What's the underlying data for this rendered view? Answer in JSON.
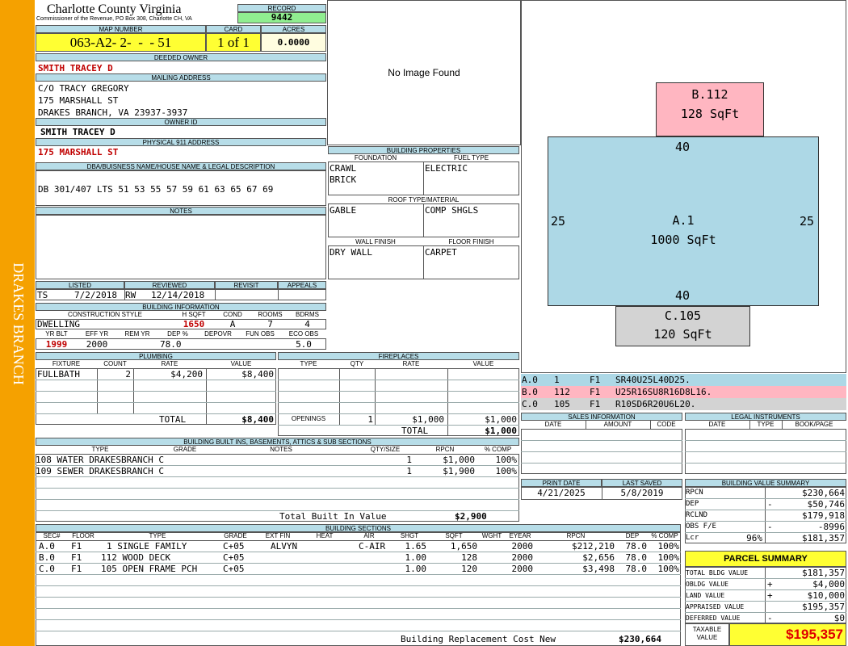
{
  "side_label": "DRAKES BRANCH",
  "county": {
    "title": "Charlotte County Virginia",
    "subtitle": "Commissioner of the Revenue, PO Box 308, Charlotte CH, VA"
  },
  "record": {
    "label": "RECORD",
    "value": "9442"
  },
  "map": {
    "label": "MAP NUMBER",
    "value": "063-A2- 2-  -  - 51"
  },
  "card": {
    "label": "CARD",
    "value": "1 of 1"
  },
  "acres": {
    "label": "ACRES",
    "value": "0.0000"
  },
  "deeded_owner": {
    "label": "DEEDED OWNER",
    "value": "SMITH TRACEY D"
  },
  "mailing": {
    "label": "MAILING ADDRESS",
    "line1": "C/O TRACY GREGORY",
    "line2": "175 MARSHALL ST",
    "line3": "DRAKES BRANCH, VA 23937-3937"
  },
  "owner_id": {
    "label": "OWNER ID",
    "value": "SMITH TRACEY D"
  },
  "physical": {
    "label": "PHYSICAL 911 ADDRESS",
    "value": "175 MARSHALL ST"
  },
  "dba": {
    "label": "DBA/BUISNESS NAME/HOUSE NAME & LEGAL DESCRIPTION",
    "value": "DB 301/407 LTS 51 53 55 57 59 61 63 65 67 69"
  },
  "notes": {
    "label": "NOTES"
  },
  "listed": {
    "label": "LISTED",
    "by": "TS",
    "date": "7/2/2018"
  },
  "reviewed": {
    "label": "REVIEWED",
    "by": "RW",
    "date": "12/14/2018"
  },
  "revisit": {
    "label": "REVISIT"
  },
  "appeals": {
    "label": "APPEALS"
  },
  "building_info": {
    "label": "BUILDING INFORMATION",
    "h_style": "CONSTRUCTION STYLE",
    "h_hsqft": "H SQFT",
    "h_cond": "COND",
    "h_rooms": "ROOMS",
    "h_bdrms": "BDRMS",
    "style": "DWELLING",
    "hsqft": "1650",
    "cond": "A",
    "rooms": "7",
    "bdrms": "4",
    "h_yrblt": "YR BLT",
    "h_effyr": "EFF YR",
    "h_remyr": "REM YR",
    "h_dep": "DEP %",
    "h_depovr": "DEPOVR",
    "h_funobs": "FUN OBS",
    "h_ecoobs": "ECO OBS",
    "yrblt": "1999",
    "effyr": "2000",
    "dep": "78.0",
    "ecoobs": "5.0"
  },
  "no_image": "No Image Found",
  "bldg_props": {
    "label": "BUILDING PROPERTIES",
    "h_foundation": "FOUNDATION",
    "h_fuel": "FUEL TYPE",
    "foundation1": "CRAWL",
    "foundation2": "BRICK",
    "fuel": "ELECTRIC",
    "h_roof": "ROOF TYPE/MATERIAL",
    "roof_type": "GABLE",
    "roof_mat": "COMP SHGLS",
    "h_wall": "WALL FINISH",
    "h_floor": "FLOOR FINISH",
    "wall": "DRY WALL",
    "floor": "CARPET"
  },
  "sketch": {
    "b_label": "B.112",
    "b_area": "128 SqFt",
    "a_label": "A.1",
    "a_area": "1000 SqFt",
    "c_label": "C.105",
    "c_area": "120 SqFt",
    "top": "40",
    "bottom": "40",
    "left": "25",
    "right": "25",
    "colors": {
      "a": "#add8e6",
      "b": "#ffb6c1",
      "c": "#d3d3d3"
    }
  },
  "sketch_codes": [
    {
      "sec": "A.0",
      "n": "1",
      "fl": "F1",
      "path": "SR40U25L40D25."
    },
    {
      "sec": "B.0",
      "n": "112",
      "fl": "F1",
      "path": "U25R16SU8R16D8L16."
    },
    {
      "sec": "C.0",
      "n": "105",
      "fl": "F1",
      "path": "R10SD6R20U6L20."
    }
  ],
  "plumbing": {
    "label": "PLUMBING",
    "h_fixture": "FIXTURE",
    "h_count": "COUNT",
    "h_rate": "RATE",
    "h_value": "VALUE",
    "fixture": "FULLBATH",
    "count": "2",
    "rate": "$4,200",
    "value": "$8,400",
    "total_label": "TOTAL",
    "total": "$8,400"
  },
  "fireplaces": {
    "label": "FIREPLACES",
    "h_type": "TYPE",
    "h_qty": "QTY",
    "h_rate": "RATE",
    "h_value": "VALUE",
    "openings_label": "OPENINGS",
    "qty": "1",
    "rate": "$1,000",
    "value": "$1,000",
    "total_label": "TOTAL",
    "total": "$1,000"
  },
  "sales": {
    "label": "SALES INFORMATION",
    "h_date": "DATE",
    "h_amount": "AMOUNT",
    "h_code": "CODE"
  },
  "legal": {
    "label": "LEGAL INSTRUMENTS",
    "h_date": "DATE",
    "h_type": "TYPE",
    "h_book": "BOOK/PAGE"
  },
  "builtins": {
    "label": "BUILDING BUILT INS, BASEMENTS, ATTICS & SUB SECTIONS",
    "h_type": "TYPE",
    "h_grade": "GRADE",
    "h_notes": "NOTES",
    "h_qty": "QTY/SIZE",
    "h_rpcn": "RPCN",
    "h_comp": "% COMP",
    "rows": [
      {
        "type": "108 WATER DRAKESBRANCH C",
        "qty": "1",
        "rpcn": "$1,000",
        "comp": "100%"
      },
      {
        "type": "109 SEWER DRAKESBRANCH C",
        "qty": "1",
        "rpcn": "$1,900",
        "comp": "100%"
      }
    ],
    "total_label": "Total Built In Value",
    "total": "$2,900"
  },
  "print": {
    "h_print": "PRINT DATE",
    "h_saved": "LAST SAVED",
    "print_date": "4/21/2025",
    "last_saved": "5/8/2019"
  },
  "value_summary": {
    "label": "BUILDING VALUE SUMMARY",
    "rows": [
      {
        "k": "RPCN",
        "s": "",
        "v": "$230,664"
      },
      {
        "k": "DEP",
        "s": "-",
        "v": "$50,746"
      },
      {
        "k": "RCLND",
        "s": "",
        "v": "$179,918"
      },
      {
        "k": "OBS F/E",
        "s": "-",
        "v": "-8996"
      },
      {
        "k": "Lcr",
        "p": "96%",
        "s": "",
        "v": "$181,357"
      }
    ]
  },
  "sections": {
    "label": "BUILDING SECTIONS",
    "h": [
      "SEC#",
      "FLOOR",
      "TYPE",
      "GRADE",
      "EXT FIN",
      "HEAT",
      "AIR",
      "SHGT",
      "SQFT",
      "WGHT",
      "EYEAR",
      "RPCN",
      "DEP",
      "% COMP"
    ],
    "rows": [
      {
        "sec": "A.0",
        "floor": "F1",
        "type": "1 SINGLE FAMILY",
        "grade": "C+05",
        "ext": "ALVYN",
        "heat": "",
        "air": "C-AIR",
        "shgt": "1.65",
        "sqft": "1,650",
        "wght": "",
        "eyear": "2000",
        "rpcn": "$212,210",
        "dep": "78.0",
        "comp": "100%"
      },
      {
        "sec": "B.0",
        "floor": "F1",
        "type": "112 WOOD DECK",
        "grade": "C+05",
        "ext": "",
        "heat": "",
        "air": "",
        "shgt": "1.00",
        "sqft": "128",
        "wght": "",
        "eyear": "2000",
        "rpcn": "$2,656",
        "dep": "78.0",
        "comp": "100%"
      },
      {
        "sec": "C.0",
        "floor": "F1",
        "type": "105 OPEN FRAME PCH",
        "grade": "C+05",
        "ext": "",
        "heat": "",
        "air": "",
        "shgt": "1.00",
        "sqft": "120",
        "wght": "",
        "eyear": "2000",
        "rpcn": "$3,498",
        "dep": "78.0",
        "comp": "100%"
      }
    ],
    "total_label": "Building Replacement Cost New",
    "total": "$230,664"
  },
  "parcel": {
    "label": "PARCEL SUMMARY",
    "rows": [
      {
        "k": "TOTAL BLDG VALUE",
        "s": "",
        "v": "$181,357"
      },
      {
        "k": "OBLDG VALUE",
        "s": "+",
        "v": "$4,000"
      },
      {
        "k": "LAND VALUE",
        "s": "+",
        "v": "$10,000"
      },
      {
        "k": "APPRAISED VALUE",
        "s": "",
        "v": "$195,357"
      },
      {
        "k": "DEFERRED VALUE",
        "s": "-",
        "v": "$0"
      }
    ],
    "taxable_label1": "TAXABLE",
    "taxable_label2": "VALUE",
    "taxable": "$195,357"
  }
}
